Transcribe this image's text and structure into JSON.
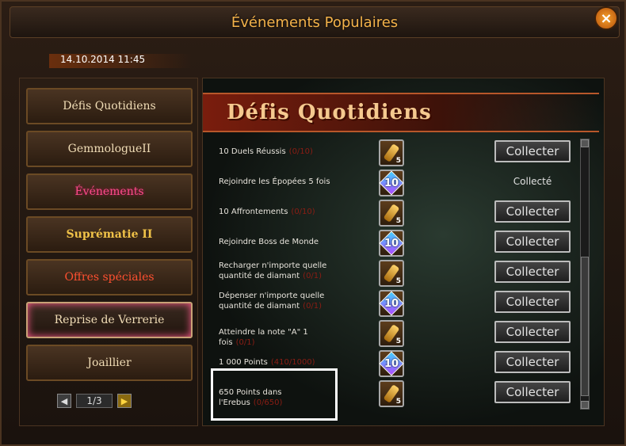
{
  "title": "Événements Populaires",
  "close_icon": "×",
  "date": "14.10.2014 11:45",
  "sidebar": {
    "items": [
      {
        "label": "Défis Quotidiens",
        "style": "normal"
      },
      {
        "label": "GemmologueII",
        "style": "normal"
      },
      {
        "label": "Événements",
        "style": "pink"
      },
      {
        "label": "Suprématie II",
        "style": "gold"
      },
      {
        "label": "Offres spéciales",
        "style": "red"
      },
      {
        "label": "Reprise de Verrerie",
        "style": "active"
      },
      {
        "label": "Joaillier",
        "style": "normal"
      }
    ],
    "pager": {
      "prev": "◀",
      "page": "1/3",
      "next": "▶"
    }
  },
  "banner": "Défis Quotidiens",
  "tasks": [
    {
      "text": "10 Duels Réussis",
      "progress": "(0/10)",
      "reward": "key",
      "qty": "5",
      "status": "Collecter"
    },
    {
      "text": "Rejoindre les Épopées 5 fois",
      "progress": "",
      "reward": "diamond",
      "qty": "10",
      "status": "Collecté"
    },
    {
      "text": "10 Affrontements",
      "progress": "(0/10)",
      "reward": "key",
      "qty": "5",
      "status": "Collecter"
    },
    {
      "text": "Rejoindre Boss de Monde",
      "progress": "",
      "reward": "diamond",
      "qty": "10",
      "status": "Collecter"
    },
    {
      "text": "Recharger n'importe quelle quantité de diamant",
      "progress": "(0/1)",
      "reward": "key",
      "qty": "5",
      "status": "Collecter"
    },
    {
      "text": "Dépenser n'importe quelle quantité de diamant",
      "progress": "(0/1)",
      "reward": "diamond",
      "qty": "10",
      "status": "Collecter"
    },
    {
      "text": "Atteindre la note \"A\" 1 fois",
      "progress": "(0/1)",
      "reward": "key",
      "qty": "5",
      "status": "Collecter"
    },
    {
      "text": "1 000 Points",
      "progress": "(410/1000)",
      "reward": "diamond",
      "qty": "10",
      "status": "Collecter"
    },
    {
      "text": "650 Points dans l'Erebus",
      "progress": "(0/650)",
      "reward": "key",
      "qty": "5",
      "status": "Collecter"
    }
  ]
}
